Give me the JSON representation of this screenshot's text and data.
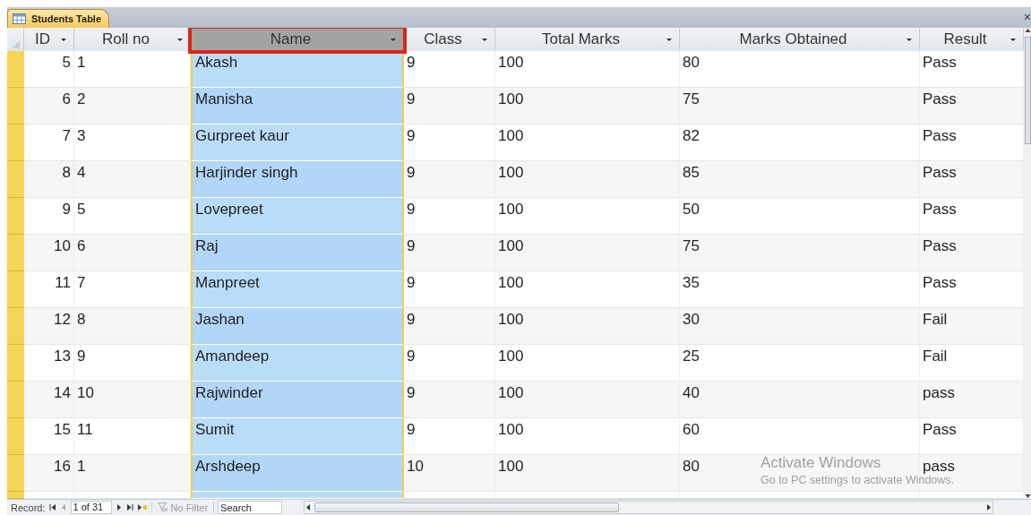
{
  "tab": {
    "title": "Students Table",
    "close": "×",
    "selected": true
  },
  "columns": [
    {
      "label": "ID",
      "selected": false
    },
    {
      "label": "Roll no",
      "selected": false
    },
    {
      "label": "Name",
      "selected": true
    },
    {
      "label": "Class",
      "selected": false
    },
    {
      "label": "Total Marks",
      "selected": false
    },
    {
      "label": "Marks Obtained",
      "selected": false
    },
    {
      "label": "Result",
      "selected": false
    }
  ],
  "rows": [
    {
      "cells": [
        "5",
        "1",
        "Akash",
        "9",
        "100",
        "80",
        "Pass"
      ]
    },
    {
      "cells": [
        "6",
        "2",
        "Manisha",
        "9",
        "100",
        "75",
        "Pass"
      ]
    },
    {
      "cells": [
        "7",
        "3",
        "Gurpreet kaur",
        "9",
        "100",
        "82",
        "Pass"
      ]
    },
    {
      "cells": [
        "8",
        "4",
        "Harjinder singh",
        "9",
        "100",
        "85",
        "Pass"
      ]
    },
    {
      "cells": [
        "9",
        "5",
        "Lovepreet",
        "9",
        "100",
        "50",
        "Pass"
      ]
    },
    {
      "cells": [
        "10",
        "6",
        "Raj",
        "9",
        "100",
        "75",
        "Pass"
      ]
    },
    {
      "cells": [
        "11",
        "7",
        "Manpreet",
        "9",
        "100",
        "35",
        "Pass"
      ]
    },
    {
      "cells": [
        "12",
        "8",
        "Jashan",
        "9",
        "100",
        "30",
        "Fail"
      ]
    },
    {
      "cells": [
        "13",
        "9",
        "Amandeep",
        "9",
        "100",
        "25",
        "Fail"
      ]
    },
    {
      "cells": [
        "14",
        "10",
        "Rajwinder",
        "9",
        "100",
        "40",
        "pass"
      ]
    },
    {
      "cells": [
        "15",
        "11",
        "Sumit",
        "9",
        "100",
        "60",
        "Pass"
      ]
    },
    {
      "cells": [
        "16",
        "1",
        "Arshdeep",
        "10",
        "100",
        "80",
        "pass"
      ]
    }
  ],
  "navigation": {
    "label": "Record:",
    "position": "1 of 31",
    "filter": {
      "label": "No Filter",
      "disabled": true
    },
    "search": {
      "placeholder": "Search"
    }
  },
  "overlay": {
    "title": "Activate Windows",
    "subtitle": "Go to PC settings to activate Windows."
  }
}
